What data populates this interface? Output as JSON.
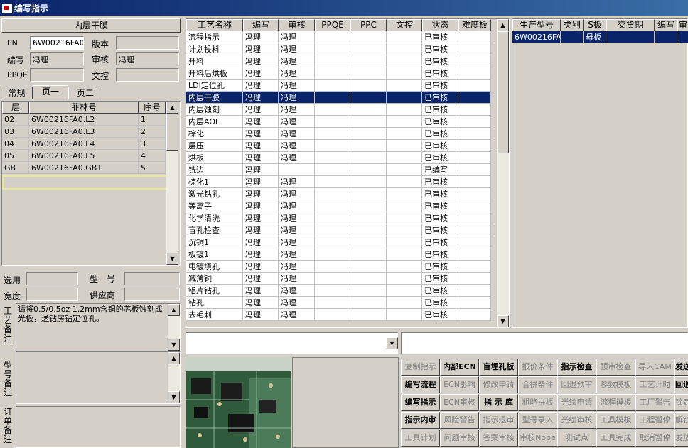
{
  "window": {
    "title": "编写指示"
  },
  "left": {
    "section_title": "内层干膜",
    "pn_label": "PN",
    "pn_value": "6W00216FA0",
    "version_label": "版本",
    "version_value": "",
    "author_label": "编写",
    "author_value": "冯理",
    "reviewer_label": "审核",
    "reviewer_value": "冯理",
    "ppqe_label": "PPQE",
    "ppqe_value": "",
    "wenkong_label": "文控",
    "wenkong_value": "",
    "tabs": [
      "常规",
      "页一",
      "页二"
    ],
    "layer_table": {
      "headers": [
        "层",
        "菲林号",
        "序号"
      ],
      "rows": [
        [
          "02",
          "6W00216FA0.L2",
          "1"
        ],
        [
          "03",
          "6W00216FA0.L3",
          "2"
        ],
        [
          "04",
          "6W00216FA0.L4",
          "3"
        ],
        [
          "05",
          "6W00216FA0.L5",
          "4"
        ],
        [
          "GB",
          "6W00216FA0.GB1",
          "5"
        ]
      ]
    },
    "select_label": "选用",
    "select_value": "",
    "model_label": "型　号",
    "model_value": "",
    "width_label": "宽度",
    "width_value": "",
    "supplier_label": "供应商",
    "supplier_value": "",
    "process_note_label": "工艺备注",
    "process_note_text": "请将0.5/0.5oz 1.2mm含铜的芯板蚀刻成光板，送钻房钻定位孔。",
    "model_note_label": "型号备注",
    "order_note_label": "订单备注"
  },
  "process_table": {
    "headers": [
      "工艺名称",
      "编写",
      "审核",
      "PPQE",
      "PPC",
      "文控",
      "状态",
      "难度板"
    ],
    "selected_index": 5,
    "rows": [
      [
        "流程指示",
        "冯理",
        "冯理",
        "",
        "",
        "",
        "已审核",
        ""
      ],
      [
        "计划投料",
        "冯理",
        "冯理",
        "",
        "",
        "",
        "已审核",
        ""
      ],
      [
        "开料",
        "冯理",
        "冯理",
        "",
        "",
        "",
        "已审核",
        ""
      ],
      [
        "开料后烘板",
        "冯理",
        "冯理",
        "",
        "",
        "",
        "已审核",
        ""
      ],
      [
        "LDI定位孔",
        "冯理",
        "冯理",
        "",
        "",
        "",
        "已审核",
        ""
      ],
      [
        "内层干膜",
        "冯理",
        "冯理",
        "",
        "",
        "",
        "已审核",
        ""
      ],
      [
        "内层蚀刻",
        "冯理",
        "冯理",
        "",
        "",
        "",
        "已审核",
        ""
      ],
      [
        "内层AOI",
        "冯理",
        "冯理",
        "",
        "",
        "",
        "已审核",
        ""
      ],
      [
        "棕化",
        "冯理",
        "冯理",
        "",
        "",
        "",
        "已审核",
        ""
      ],
      [
        "层压",
        "冯理",
        "冯理",
        "",
        "",
        "",
        "已审核",
        ""
      ],
      [
        "烘板",
        "冯理",
        "冯理",
        "",
        "",
        "",
        "已审核",
        ""
      ],
      [
        "铣边",
        "冯理",
        "",
        "",
        "",
        "",
        "已编写",
        ""
      ],
      [
        "棕化1",
        "冯理",
        "冯理",
        "",
        "",
        "",
        "已审核",
        ""
      ],
      [
        "激光钻孔",
        "冯理",
        "冯理",
        "",
        "",
        "",
        "已审核",
        ""
      ],
      [
        "等离子",
        "冯理",
        "冯理",
        "",
        "",
        "",
        "已审核",
        ""
      ],
      [
        "化学清洗",
        "冯理",
        "冯理",
        "",
        "",
        "",
        "已审核",
        ""
      ],
      [
        "盲孔检查",
        "冯理",
        "冯理",
        "",
        "",
        "",
        "已审核",
        ""
      ],
      [
        "沉铜1",
        "冯理",
        "冯理",
        "",
        "",
        "",
        "已审核",
        ""
      ],
      [
        "板镀1",
        "冯理",
        "冯理",
        "",
        "",
        "",
        "已审核",
        ""
      ],
      [
        "电镀填孔",
        "冯理",
        "冯理",
        "",
        "",
        "",
        "已审核",
        ""
      ],
      [
        "减薄铜",
        "冯理",
        "冯理",
        "",
        "",
        "",
        "已审核",
        ""
      ],
      [
        "铝片钻孔",
        "冯理",
        "冯理",
        "",
        "",
        "",
        "已审核",
        ""
      ],
      [
        "钻孔",
        "冯理",
        "冯理",
        "",
        "",
        "",
        "已审核",
        ""
      ],
      [
        "去毛刺",
        "冯理",
        "冯理",
        "",
        "",
        "",
        "已审核",
        ""
      ]
    ]
  },
  "product_table": {
    "headers": [
      "生产型号",
      "类别",
      "S板",
      "交货期",
      "编写",
      "审"
    ],
    "rows": [
      [
        "6W00216FA0",
        "",
        "母板",
        "",
        "",
        ""
      ]
    ]
  },
  "buttons": {
    "rows": [
      [
        {
          "label": "复制指示",
          "on": false
        },
        {
          "label": "内部ECN",
          "on": true
        },
        {
          "label": "盲埋孔板",
          "on": true
        },
        {
          "label": "报价条件",
          "on": false
        },
        {
          "label": "指示检查",
          "on": true
        },
        {
          "label": "预审检查",
          "on": false
        },
        {
          "label": "导入CAM",
          "on": false
        },
        {
          "label": "发送",
          "on": true
        }
      ],
      [
        {
          "label": "编写流程",
          "on": true
        },
        {
          "label": "ECN影响",
          "on": false
        },
        {
          "label": "修改申请",
          "on": false
        },
        {
          "label": "合拼条件",
          "on": false
        },
        {
          "label": "回退预审",
          "on": false
        },
        {
          "label": "参数模板",
          "on": false
        },
        {
          "label": "工艺计时",
          "on": false
        },
        {
          "label": "回退",
          "on": true
        }
      ],
      [
        {
          "label": "编写指示",
          "on": true
        },
        {
          "label": "ECN审核",
          "on": false
        },
        {
          "label": "指 示 库",
          "on": true
        },
        {
          "label": "粗略拼板",
          "on": false
        },
        {
          "label": "光绘申请",
          "on": false
        },
        {
          "label": "流程模板",
          "on": false
        },
        {
          "label": "工厂警告",
          "on": false
        },
        {
          "label": "锁定",
          "on": false
        }
      ],
      [
        {
          "label": "指示内审",
          "on": true
        },
        {
          "label": "风险警告",
          "on": false
        },
        {
          "label": "指示退审",
          "on": false
        },
        {
          "label": "型号录入",
          "on": false
        },
        {
          "label": "光绘审核",
          "on": false
        },
        {
          "label": "工具模板",
          "on": false
        },
        {
          "label": "工程暂停",
          "on": false
        },
        {
          "label": "解锁",
          "on": false
        }
      ],
      [
        {
          "label": "工具计划",
          "on": false
        },
        {
          "label": "问题审核",
          "on": false
        },
        {
          "label": "答案审核",
          "on": false
        },
        {
          "label": "审核Nope",
          "on": false
        },
        {
          "label": "测试点",
          "on": false
        },
        {
          "label": "工具完成",
          "on": false
        },
        {
          "label": "取消暂停",
          "on": false
        },
        {
          "label": "发放",
          "on": false
        }
      ]
    ]
  }
}
